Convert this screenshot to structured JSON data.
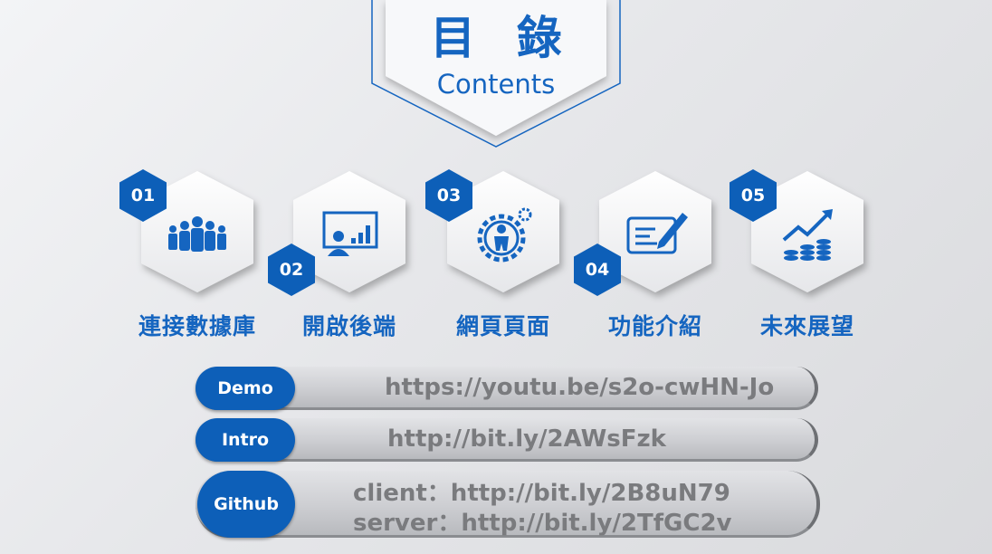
{
  "header": {
    "title": "目 錄",
    "subtitle": "Contents"
  },
  "sections": [
    {
      "number": "01",
      "label": "連接數據庫",
      "icon": "team-people-icon"
    },
    {
      "number": "02",
      "label": "開啟後端",
      "icon": "presentation-board-icon"
    },
    {
      "number": "03",
      "label": "網頁頁面",
      "icon": "gear-worker-icon"
    },
    {
      "number": "04",
      "label": "功能介紹",
      "icon": "document-pen-icon"
    },
    {
      "number": "05",
      "label": "未來展望",
      "icon": "growth-coins-icon"
    }
  ],
  "links": {
    "demo": {
      "label": "Demo",
      "url": "https://youtu.be/s2o-cwHN-Jo"
    },
    "intro": {
      "label": "Intro",
      "url": "http://bit.ly/2AWsFzk"
    },
    "github": {
      "label": "Github",
      "client": "client：http://bit.ly/2B8uN79",
      "server": "server：http://bit.ly/2TfGC2v"
    }
  },
  "colors": {
    "accent": "#1565c0",
    "badge": "#0d5fb8",
    "link_text": "#7a7b7e"
  }
}
